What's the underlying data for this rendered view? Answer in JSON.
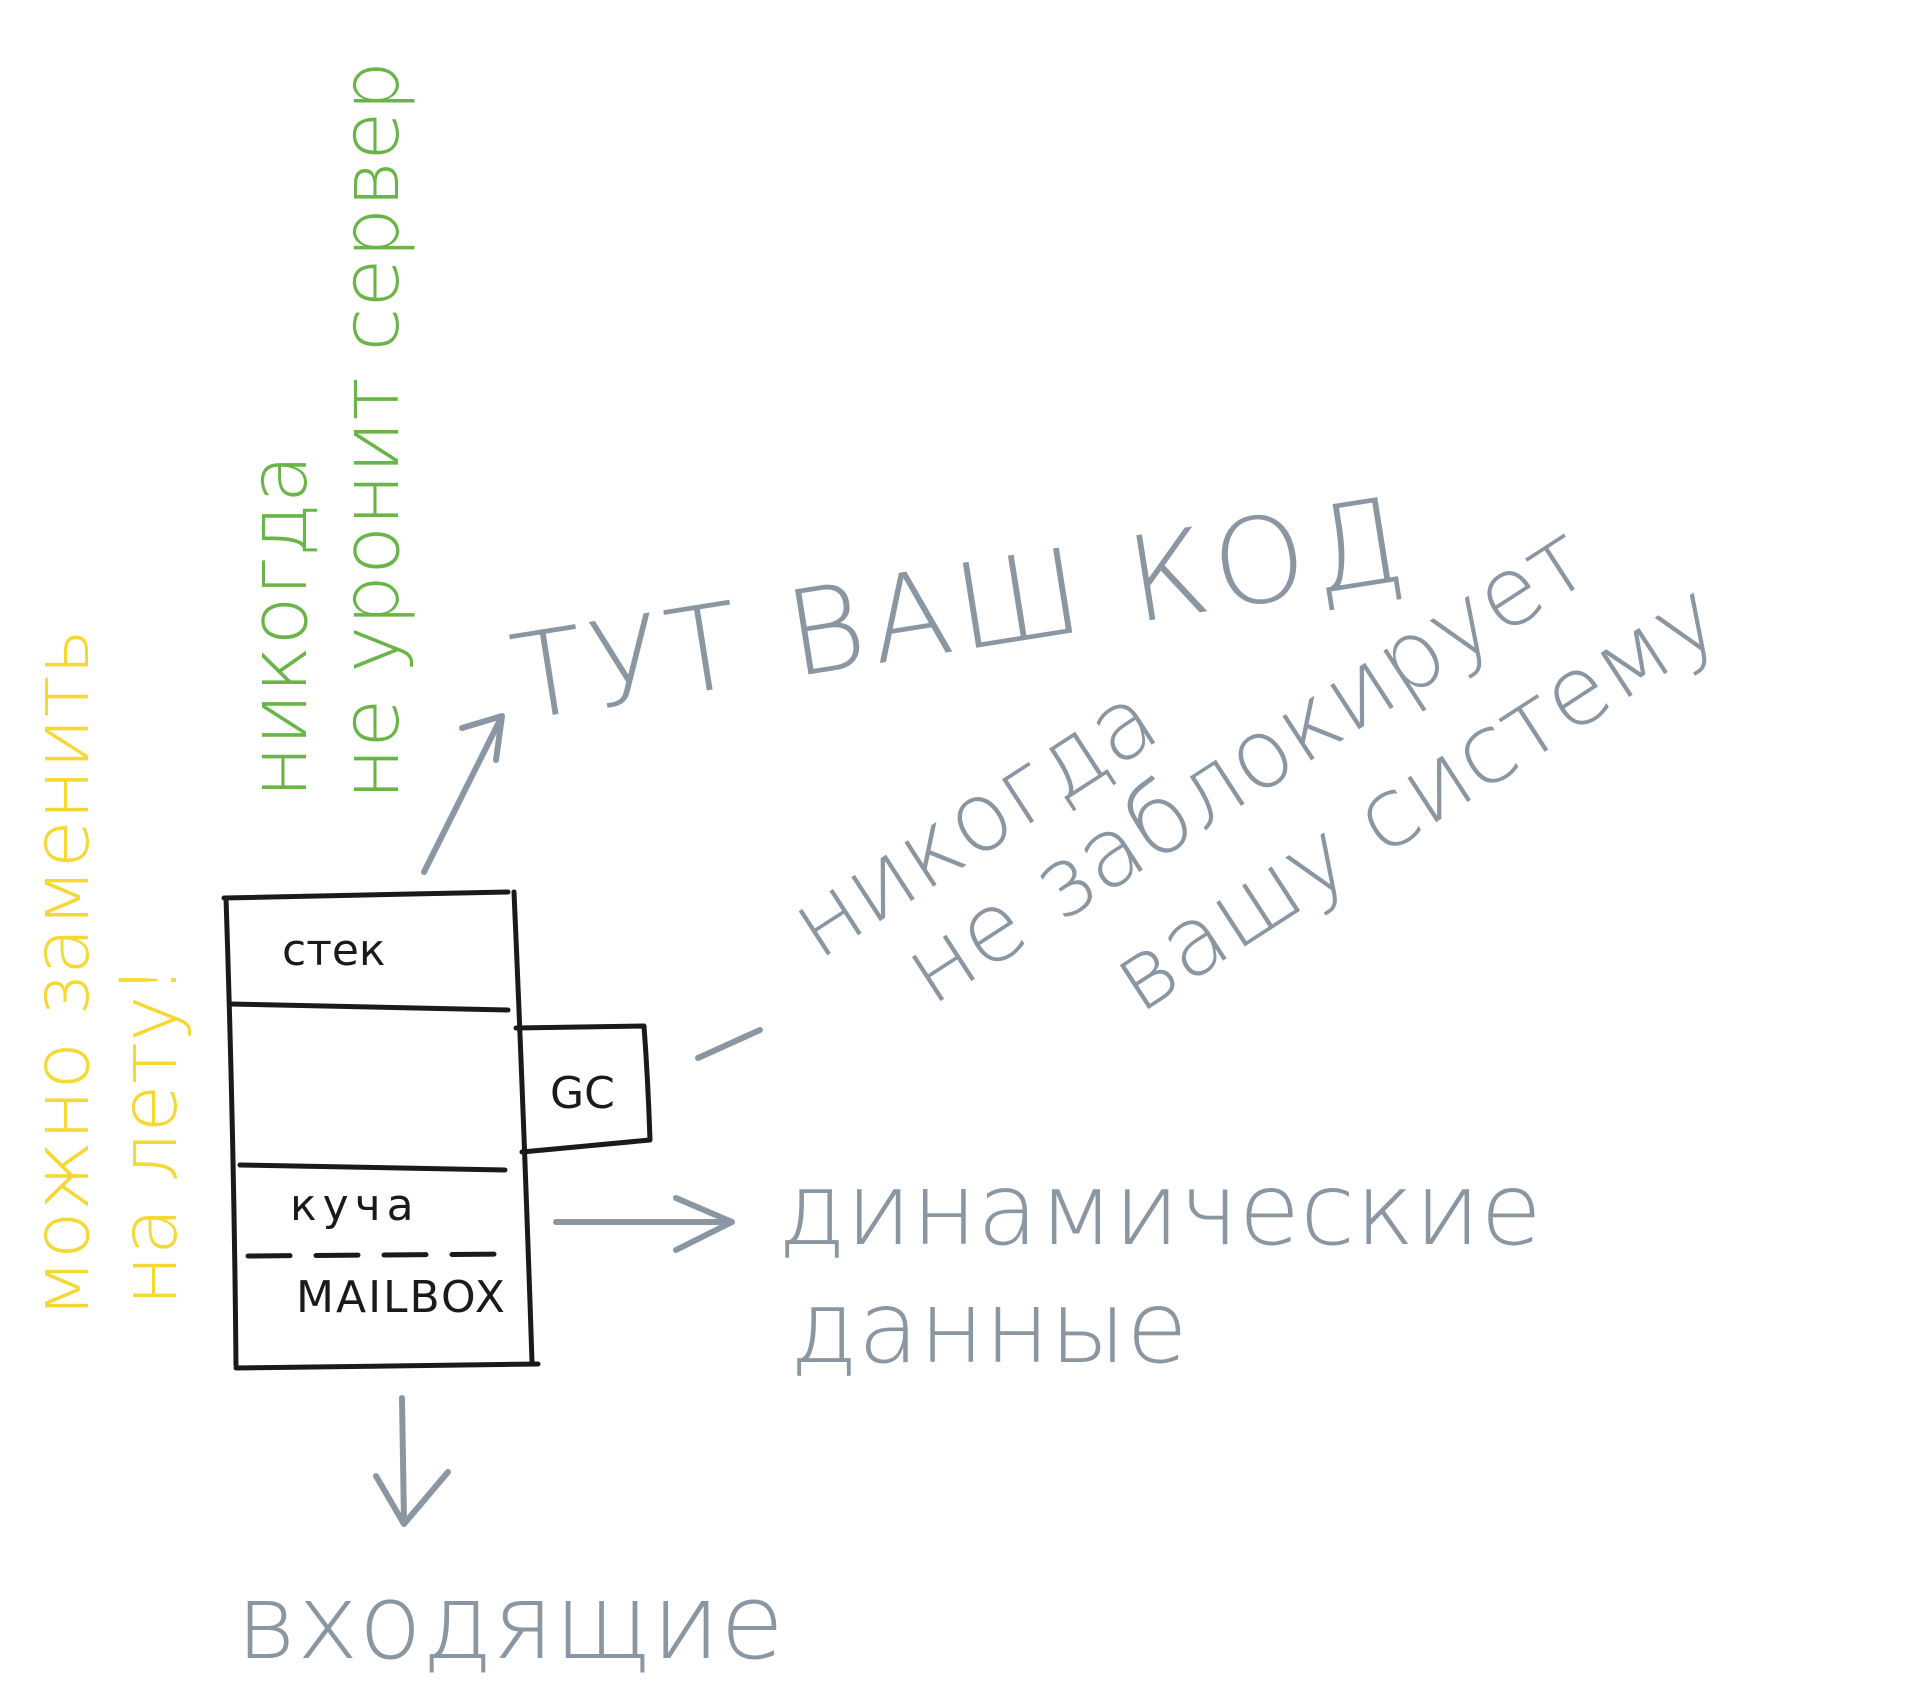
{
  "colors": {
    "ink": "#1a1a1a",
    "annotation_gray": "#8a97a3",
    "annotation_green": "#6ab547",
    "annotation_yellow": "#f6d832",
    "background": "#ffffff"
  },
  "process_box": {
    "sections": {
      "stack": "стек",
      "heap": "куча",
      "mailbox": "MAILBOX"
    },
    "gc": "GC"
  },
  "annotations": {
    "your_code": "ТУТ ВАШ КОД",
    "never_crash_line1": "никогда",
    "never_crash_line2": "не уронит сервер",
    "hot_swap_line1": "можно заменить",
    "hot_swap_line2": "на лету!",
    "gc_note_line1": "никогда",
    "gc_note_line2": "не заблокирует",
    "gc_note_line3": "вашу систему",
    "dynamic_line1": "динамические",
    "dynamic_line2": "данные",
    "incoming": "входящие"
  }
}
